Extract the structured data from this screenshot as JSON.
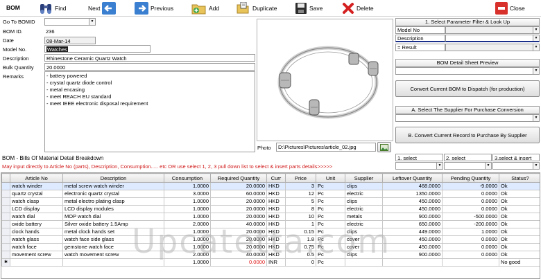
{
  "toolbar": {
    "form_title": "BOM",
    "find": "Find",
    "next": "Next",
    "previous": "Previous",
    "add": "Add",
    "duplicate": "Duplicate",
    "save": "Save",
    "delete": "Delete",
    "close": "Close"
  },
  "form": {
    "goto_label": "Go To BOMID",
    "goto_value": "",
    "bom_id_label": "BOM ID.",
    "bom_id": "236",
    "date_label": "Date",
    "date": "08-Mar-14",
    "model_label": "Model No.",
    "model": "Watches",
    "desc_label": "Description",
    "description": "Rhinestone Ceramic Quartz Watch",
    "qty_label": "Bulk Quantity",
    "qty": "20.0000",
    "remarks_label": "Remarks",
    "remarks": [
      "- battery powered",
      "- crystal quartz diode control",
      "- metal encasing",
      "- meet REACH EU standard",
      "- meet IEEE electronic disposal requirement"
    ],
    "photo_label": "Photo",
    "photo_path": "D:\\Pictures\\Pictures\\article_02.jpg"
  },
  "filter": {
    "title": "1. Select Parameter Filter & Look Up",
    "rows": [
      "Model No",
      "Description",
      "= Result"
    ],
    "preview_title": "BOM Detail Sheet Preview",
    "dispatch_btn": "Convert Current BOM to Dispatch (for production)",
    "supplier_title": "A. Select The Supplier For Purchase Conversion",
    "purchase_btn": "B. Convert Current Record to Purchase By Supplier"
  },
  "breakdown": {
    "title": "BOM - Bills Of Material Detail Breakdown",
    "hint": "May input directly to Article No (parts), Description, Consumption..... etc  OR use select 1, 2, 3 pull down list to select & insert parts details>>>>>",
    "select1": "1. select",
    "select2": "2. select",
    "select3": "3.select & insert"
  },
  "grid": {
    "columns": [
      "Article No",
      "Description",
      "Consumption",
      "Required Quantity",
      "Curr",
      "Price",
      "Unit",
      "Supplier",
      "Leftover Quantity",
      "Pending Quantity",
      "Status?"
    ],
    "rows": [
      [
        "watch winder",
        "metal screw watch winder",
        "1.0000",
        "20.0000",
        "HKD",
        "3",
        "Pc",
        "clips",
        "468.0000",
        "-9.0000",
        "Ok"
      ],
      [
        "quartz crystal",
        "electronic quartz crystal",
        "3.0000",
        "60.0000",
        "HKD",
        "12",
        "Pc",
        "electric",
        "1350.0000",
        "0.0000",
        "Ok"
      ],
      [
        "watch clasp",
        "metal electro plating clasp",
        "1.0000",
        "20.0000",
        "HKD",
        "5",
        "Pc",
        "clips",
        "450.0000",
        "0.0000",
        "Ok"
      ],
      [
        "LCD display",
        "LCD display modules",
        "1.0000",
        "20.0000",
        "HKD",
        "8",
        "Pc",
        "electric",
        "450.0000",
        "0.0000",
        "Ok"
      ],
      [
        "watch dial",
        "MOP watch dial",
        "1.0000",
        "20.0000",
        "HKD",
        "10",
        "Pc",
        "metals",
        "900.0000",
        "-500.0000",
        "Ok"
      ],
      [
        "oxide battery",
        "Silver oxide battery 1.5Amp",
        "2.0000",
        "40.0000",
        "HKD",
        "1",
        "Pc",
        "electric",
        "650.0000",
        "-200.0000",
        "Ok"
      ],
      [
        "clock hands",
        "metal clock hands set",
        "1.0000",
        "20.0000",
        "HKD",
        "0.15",
        "Pc",
        "clips",
        "449.0000",
        "1.0000",
        "Ok"
      ],
      [
        "watch glass",
        "watch face side glass",
        "1.0000",
        "20.0000",
        "HKD",
        "1.8",
        "Pc",
        "cover",
        "450.0000",
        "0.0000",
        "Ok"
      ],
      [
        "watch face",
        "gemstone watch face",
        "1.0000",
        "20.0000",
        "HKD",
        "0.75",
        "Pc",
        "cover",
        "450.0000",
        "0.0000",
        "Ok"
      ],
      [
        "movement screw",
        "watch movement screw",
        "2.0000",
        "40.0000",
        "HKD",
        "0.5",
        "Pc",
        "clips",
        "900.0000",
        "0.0000",
        "Ok"
      ],
      [
        "",
        "",
        "1.0000",
        "0.0000",
        "INR",
        "0",
        "Pc",
        "",
        "",
        "",
        "No good"
      ]
    ]
  },
  "watermark": "Upcatetta.com"
}
